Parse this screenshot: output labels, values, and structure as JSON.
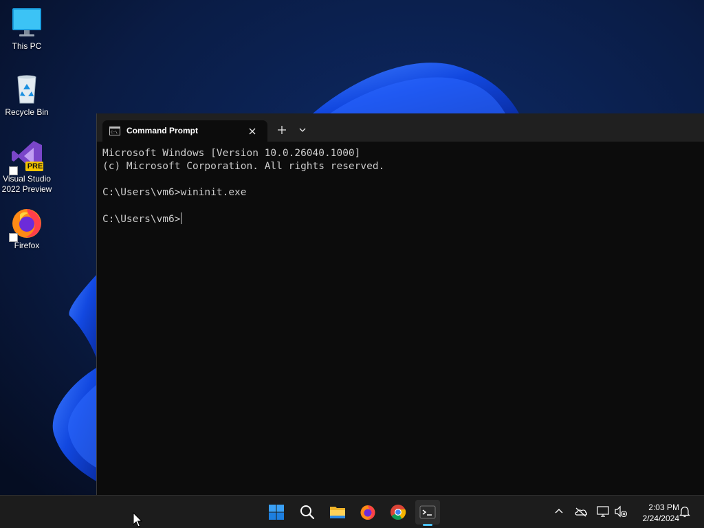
{
  "desktop": {
    "icons": [
      {
        "label": "This PC",
        "icon": "monitor-icon"
      },
      {
        "label": "Recycle Bin",
        "icon": "recycle-bin-icon"
      },
      {
        "label": "Visual Studio 2022 Preview",
        "icon": "visual-studio-icon",
        "badge": "PRE"
      },
      {
        "label": "Firefox",
        "icon": "firefox-icon"
      }
    ]
  },
  "terminal": {
    "tab_title": "Command Prompt",
    "lines": [
      "Microsoft Windows [Version 10.0.26040.1000]",
      "(c) Microsoft Corporation. All rights reserved.",
      "",
      "C:\\Users\\vm6>wininit.exe",
      "",
      "C:\\Users\\vm6>"
    ],
    "background": "#0c0c0c",
    "foreground": "#cccccc"
  },
  "taskbar": {
    "apps": [
      "start-icon",
      "search-icon",
      "file-explorer-icon",
      "firefox-icon",
      "chrome-icon",
      "terminal-icon"
    ],
    "tray": [
      "chevron-up-icon",
      "onedrive-icon",
      "network-icon",
      "volume-muted-icon",
      "notification-bell-icon"
    ],
    "time": "2:03 PM",
    "date": "2/24/2024",
    "accent": "#4cc2ff"
  }
}
